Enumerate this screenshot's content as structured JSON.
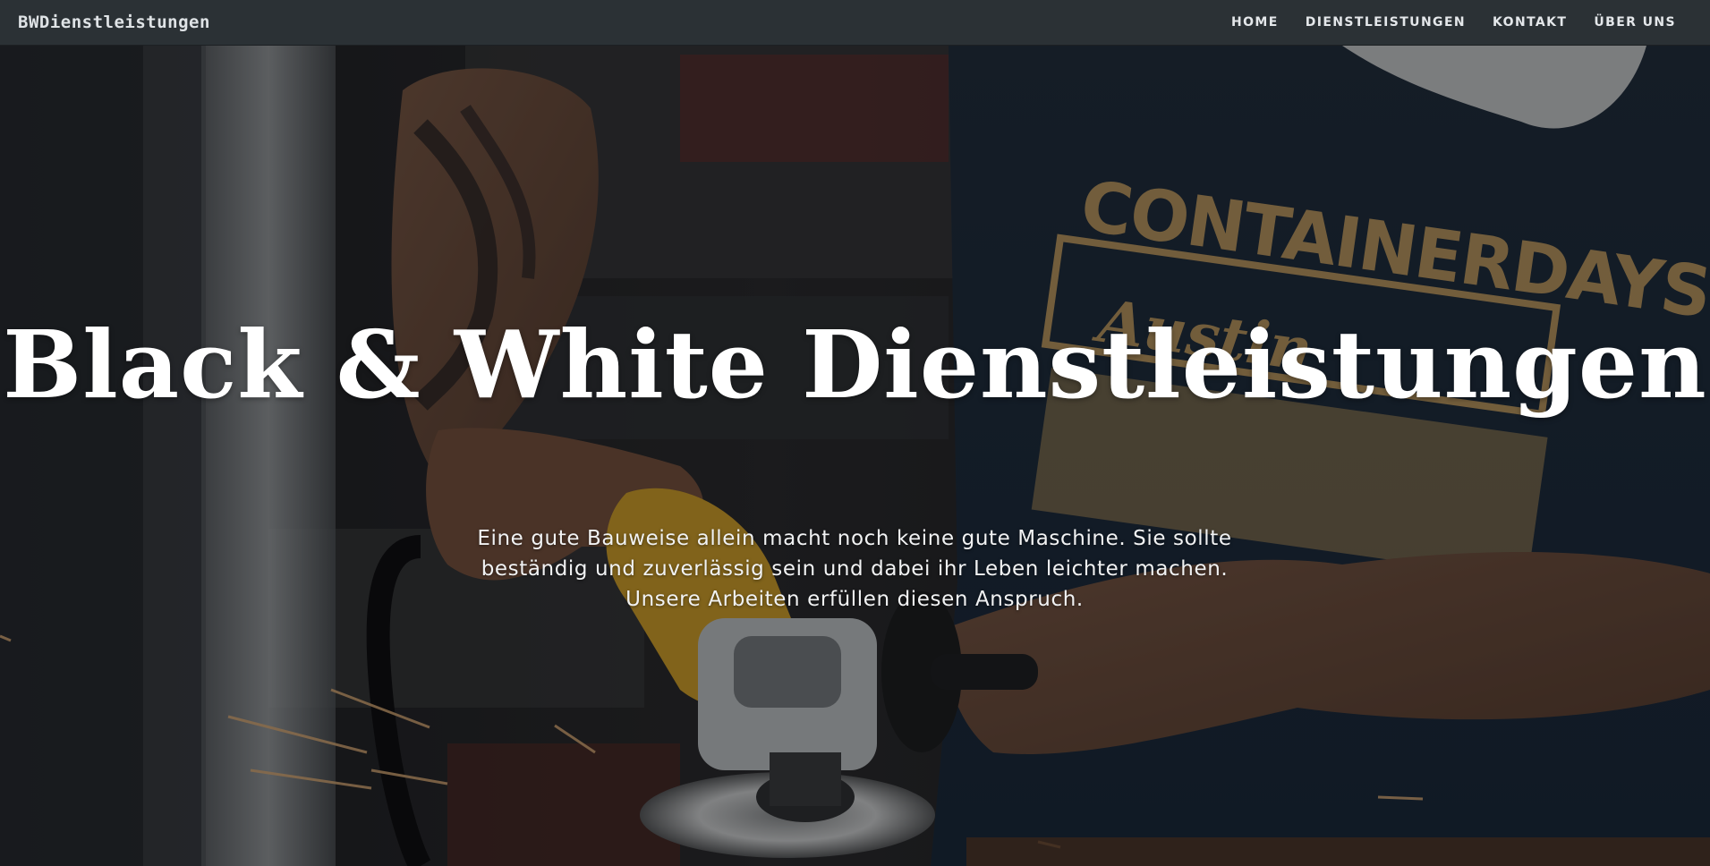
{
  "navbar": {
    "brand": "BWDienstleistungen",
    "links": [
      {
        "label": "HOME"
      },
      {
        "label": "DIENSTLEISTUNGEN"
      },
      {
        "label": "KONTAKT"
      },
      {
        "label": "ÜBER UNS"
      }
    ]
  },
  "hero": {
    "title": "Black & White Dienstleistungen",
    "text": "Eine gute Bauweise allein macht noch keine gute Maschine. Sie sollte beständig und zuverlässig sein und dabei ihr Leben leichter machen. Unsere Arbeiten erfüllen diesen Anspruch.",
    "background_image": "worker-using-angle-grinder-photo",
    "shirt_print": "CONTAINER DAYS Austin"
  },
  "colors": {
    "navbar_bg": "#2b3135",
    "text": "#ffffff",
    "shirt_print": "#c9a263"
  }
}
